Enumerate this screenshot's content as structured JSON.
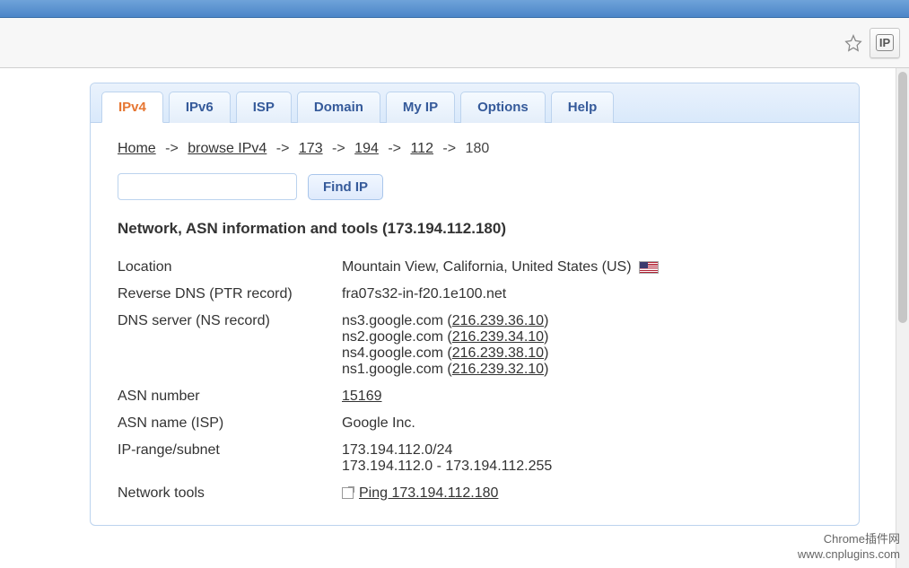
{
  "toolbar": {
    "ext_label": "IP"
  },
  "tabs": [
    {
      "id": "ipv4",
      "label": "IPv4",
      "active": true
    },
    {
      "id": "ipv6",
      "label": "IPv6",
      "active": false
    },
    {
      "id": "isp",
      "label": "ISP",
      "active": false
    },
    {
      "id": "domain",
      "label": "Domain",
      "active": false
    },
    {
      "id": "myip",
      "label": "My IP",
      "active": false
    },
    {
      "id": "options",
      "label": "Options",
      "active": false
    },
    {
      "id": "help",
      "label": "Help",
      "active": false
    }
  ],
  "breadcrumb": {
    "items": [
      "Home",
      "browse IPv4",
      "173",
      "194",
      "112"
    ],
    "current": "180",
    "sep": "->"
  },
  "search": {
    "value": "",
    "button": "Find IP"
  },
  "heading": "Network, ASN information and tools (173.194.112.180)",
  "rows": {
    "location": {
      "label": "Location",
      "value": "Mountain View, California, United States (US)"
    },
    "rdns": {
      "label": "Reverse DNS (PTR record)",
      "value": "fra07s32-in-f20.1e100.net"
    },
    "dns": {
      "label": "DNS server (NS record)",
      "servers": [
        {
          "host": "ns3.google.com",
          "ip": "216.239.36.10"
        },
        {
          "host": "ns2.google.com",
          "ip": "216.239.34.10"
        },
        {
          "host": "ns4.google.com",
          "ip": "216.239.38.10"
        },
        {
          "host": "ns1.google.com",
          "ip": "216.239.32.10"
        }
      ]
    },
    "asn_num": {
      "label": "ASN number",
      "value": "15169"
    },
    "asn_name": {
      "label": "ASN name (ISP)",
      "value": "Google Inc."
    },
    "range": {
      "label": "IP-range/subnet",
      "line1": "173.194.112.0/24",
      "line2": "173.194.112.0 - 173.194.112.255"
    },
    "tools": {
      "label": "Network tools",
      "link": "Ping 173.194.112.180"
    }
  },
  "watermark": {
    "line1": "Chrome插件网",
    "line2": "www.cnplugins.com"
  }
}
